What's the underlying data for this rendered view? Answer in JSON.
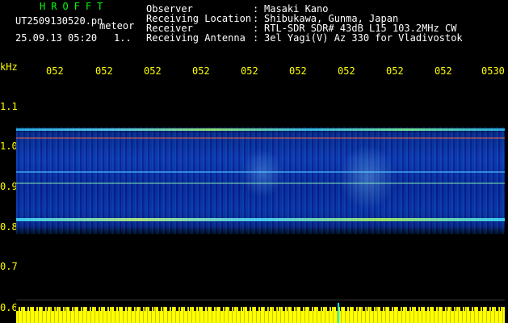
{
  "app": {
    "title": "HROFFT"
  },
  "file": {
    "name": "UT2509130520.pn",
    "type_label": "meteor",
    "datetime": "25.09.13 05:20",
    "counter": "1.."
  },
  "info": [
    {
      "label": "Observer",
      "value": "Masaki Kano"
    },
    {
      "label": "Receiving Location",
      "value": "Shibukawa, Gunma, Japan"
    },
    {
      "label": "Receiver",
      "value": "RTL-SDR SDR# 43dB L15 103.2MHz CW"
    },
    {
      "label": "Receiving Antenna",
      "value": "3el Yagi(V) Az 330 for Vladivostok"
    }
  ],
  "separator": ":",
  "time_axis": {
    "ticks": [
      "052",
      "052",
      "052",
      "052",
      "052",
      "052",
      "052",
      "052",
      "052",
      "0530"
    ]
  },
  "freq_axis": {
    "unit": "kHz",
    "ticks": [
      "1.1",
      "1.0",
      "0.9",
      "0.8",
      "0.7",
      "0.6"
    ]
  },
  "colors": {
    "header_green": "#00ff00",
    "text_white": "#ffffff",
    "axis_yellow": "#ffff00",
    "background": "#000000"
  }
}
